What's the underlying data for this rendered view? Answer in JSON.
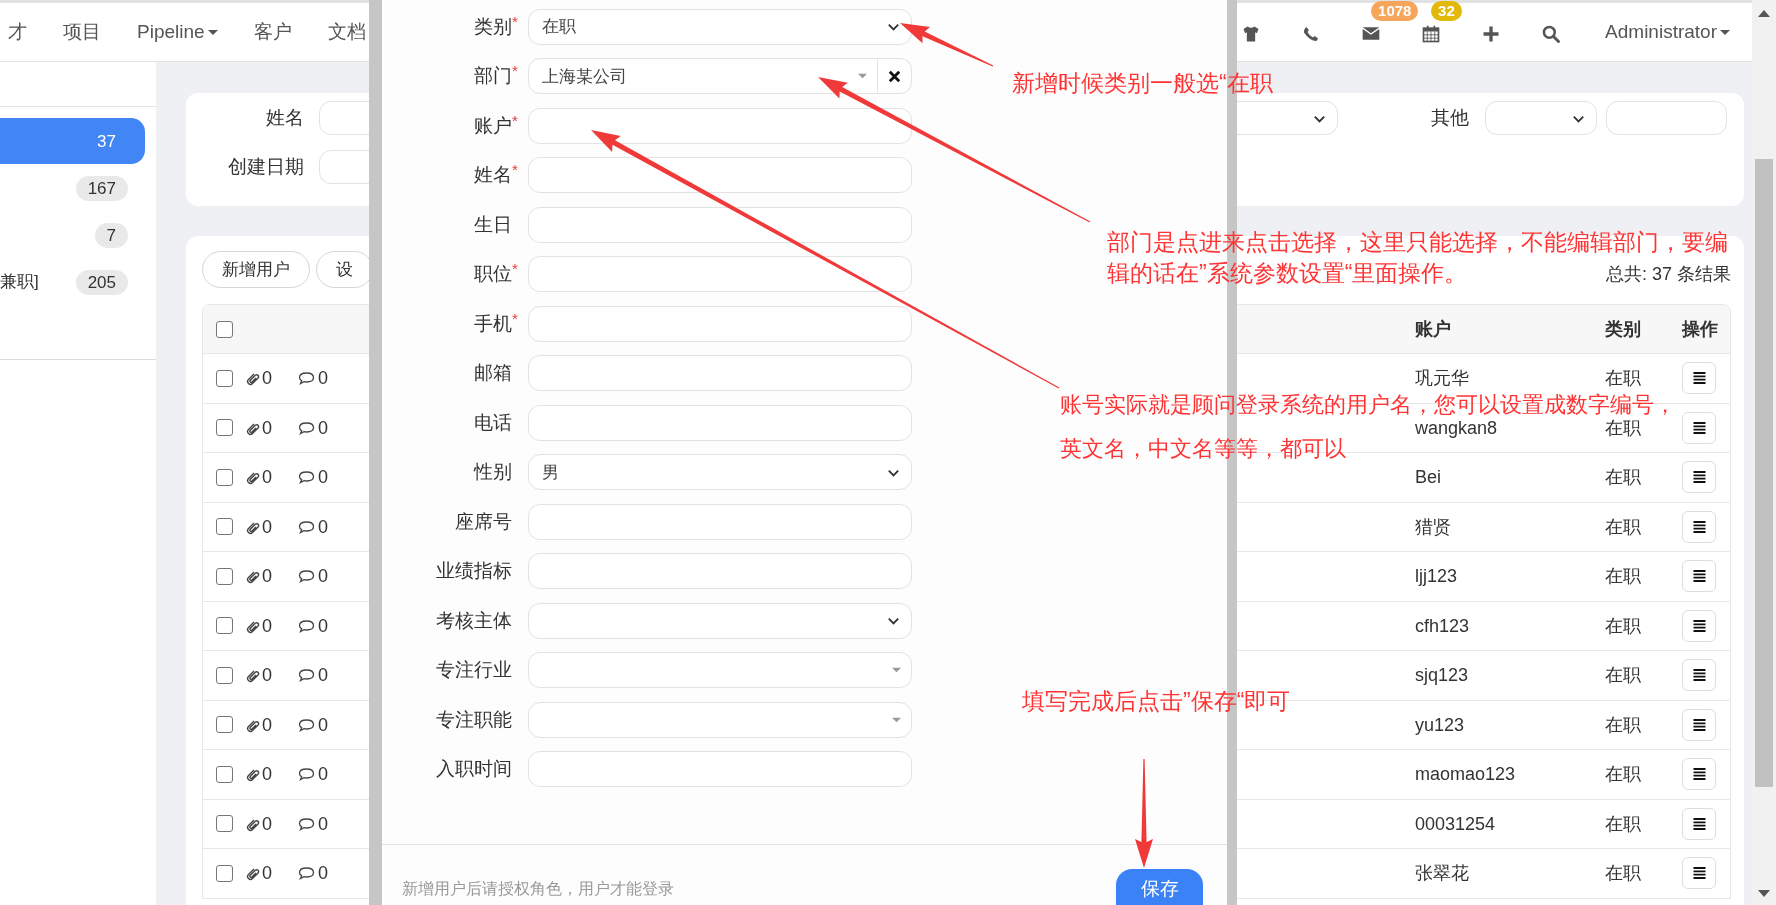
{
  "nav": {
    "items": [
      {
        "label": "才",
        "kind": "link"
      },
      {
        "label": "项目",
        "kind": "link"
      },
      {
        "label": "Pipeline",
        "kind": "dropdown"
      },
      {
        "label": "客户",
        "kind": "link"
      },
      {
        "label": "文档",
        "kind": "link"
      }
    ],
    "icons": [
      {
        "kind": "shirt"
      },
      {
        "kind": "phone"
      },
      {
        "kind": "mail",
        "badge": "1078",
        "color": "#f5a65b"
      },
      {
        "kind": "calendar",
        "badge": "32",
        "color": "#e2b909"
      },
      {
        "kind": "plus"
      },
      {
        "kind": "search"
      }
    ],
    "user": "Administrator"
  },
  "sidebar": {
    "items": [
      {
        "count": "37",
        "selected": true
      },
      {
        "count": "167",
        "selected": false
      },
      {
        "count": "7",
        "selected": false
      },
      {
        "label": "兼职]",
        "count": "205",
        "selected": false
      }
    ]
  },
  "filters": {
    "name_label": "姓名",
    "date_label": "创建日期",
    "other_label": "其他"
  },
  "table": {
    "buttons": [
      "新增用户",
      "设"
    ],
    "total": "总共: 37 条结果",
    "columns": [
      "账户",
      "类别",
      "操作"
    ],
    "select_all_checked": false,
    "rows": [
      {
        "checked": false,
        "attachments": "0",
        "comments": "0",
        "account": "巩元华",
        "type": "在职"
      },
      {
        "checked": false,
        "attachments": "0",
        "comments": "0",
        "account": "wangkan8",
        "type": "在职"
      },
      {
        "checked": false,
        "attachments": "0",
        "comments": "0",
        "account": "Bei",
        "type": "在职"
      },
      {
        "checked": false,
        "attachments": "0",
        "comments": "0",
        "account": "猎贤",
        "type": "在职"
      },
      {
        "checked": false,
        "attachments": "0",
        "comments": "0",
        "account": "ljj123",
        "type": "在职"
      },
      {
        "checked": false,
        "attachments": "0",
        "comments": "0",
        "account": "cfh123",
        "type": "在职"
      },
      {
        "checked": false,
        "attachments": "0",
        "comments": "0",
        "account": "sjq123",
        "type": "在职"
      },
      {
        "checked": false,
        "attachments": "0",
        "comments": "0",
        "account": "yu123",
        "type": "在职"
      },
      {
        "checked": false,
        "attachments": "0",
        "comments": "0",
        "account": "maomao123",
        "type": "在职"
      },
      {
        "checked": false,
        "attachments": "0",
        "comments": "0",
        "account": "00031254",
        "type": "在职"
      },
      {
        "checked": false,
        "attachments": "0",
        "comments": "0",
        "account": "张翠花",
        "type": "在职"
      }
    ]
  },
  "modal": {
    "fields": [
      {
        "label": "类别",
        "mark": "*",
        "kind": "select",
        "value": "在职"
      },
      {
        "label": "部门",
        "mark": "*",
        "kind": "combo",
        "value": "上海某公司",
        "clearable": true
      },
      {
        "label": "账户",
        "mark": "*",
        "kind": "text"
      },
      {
        "label": "姓名",
        "mark": "*",
        "kind": "text"
      },
      {
        "label": "生日",
        "kind": "text"
      },
      {
        "label": "职位",
        "mark": "*",
        "kind": "text"
      },
      {
        "label": "手机",
        "mark": "*",
        "kind": "text"
      },
      {
        "label": "邮箱",
        "kind": "text"
      },
      {
        "label": "电话",
        "kind": "text"
      },
      {
        "label": "性别",
        "kind": "select",
        "value": "男"
      },
      {
        "label": "座席号",
        "kind": "text"
      },
      {
        "label": "业绩指标",
        "kind": "text"
      },
      {
        "label": "考核主体",
        "kind": "select"
      },
      {
        "label": "专注行业",
        "kind": "combo"
      },
      {
        "label": "专注职能",
        "kind": "combo"
      },
      {
        "label": "入职时间",
        "kind": "text"
      }
    ],
    "hint": "新增用户后请授权角色，用户才能登录",
    "save": "保存"
  },
  "annotations": [
    {
      "lines": [
        "新增时候类别一般选“在职"
      ]
    },
    {
      "lines": [
        "部门是点进来点击选择，这里只能选择，不能编辑部门，要编",
        "辑的话在”系统参数设置“里面操作。"
      ]
    },
    {
      "lines": [
        "账号实际就是顾问登录系统的用户名，您可以设置成数字编号，",
        "英文名，中文名等等，都可以"
      ]
    },
    {
      "lines": [
        "填写完成后点击”保存“即可"
      ]
    }
  ]
}
